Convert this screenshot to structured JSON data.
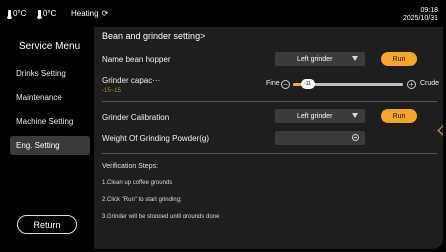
{
  "status": {
    "temp1": "0°C",
    "temp2": "0°C",
    "heating_label": "Heating",
    "heating_icon": "spinner-icon",
    "time": "09:18",
    "date": "2025/10/31"
  },
  "sidebar": {
    "title": "Service Menu",
    "items": [
      {
        "label": "Drinks Setting"
      },
      {
        "label": "Maintenance"
      },
      {
        "label": "Machine Setting"
      },
      {
        "label": "Eng. Setting"
      }
    ],
    "active_index": 3,
    "return_label": "Return"
  },
  "main": {
    "title": "Bean and grinder setting>",
    "bean_hopper": {
      "label": "Name bean hopper",
      "value": "Left grinder",
      "button": "Run"
    },
    "grinder_capacity": {
      "label": "Grinder capac···",
      "range": "-15~15",
      "fine_label": "Fine",
      "crude_label": "Crude",
      "value": "-11",
      "minus": "−",
      "plus": "+"
    },
    "calibration": {
      "label": "Grinder Calibration",
      "value": "Left grinder",
      "button": "Run"
    },
    "weight": {
      "label": "Weight Of Grinding Powder(g)",
      "value": ""
    },
    "verification": {
      "title": "Verification Steps:",
      "steps": [
        "1.Clean up coffee grounds",
        "2.Click \"Run\" to start grinding;",
        "3.Grinder will be stopped until grounds done"
      ]
    }
  },
  "colors": {
    "accent": "#f5a623",
    "panel": "#1e1e1e",
    "input": "#3b3b3b"
  }
}
